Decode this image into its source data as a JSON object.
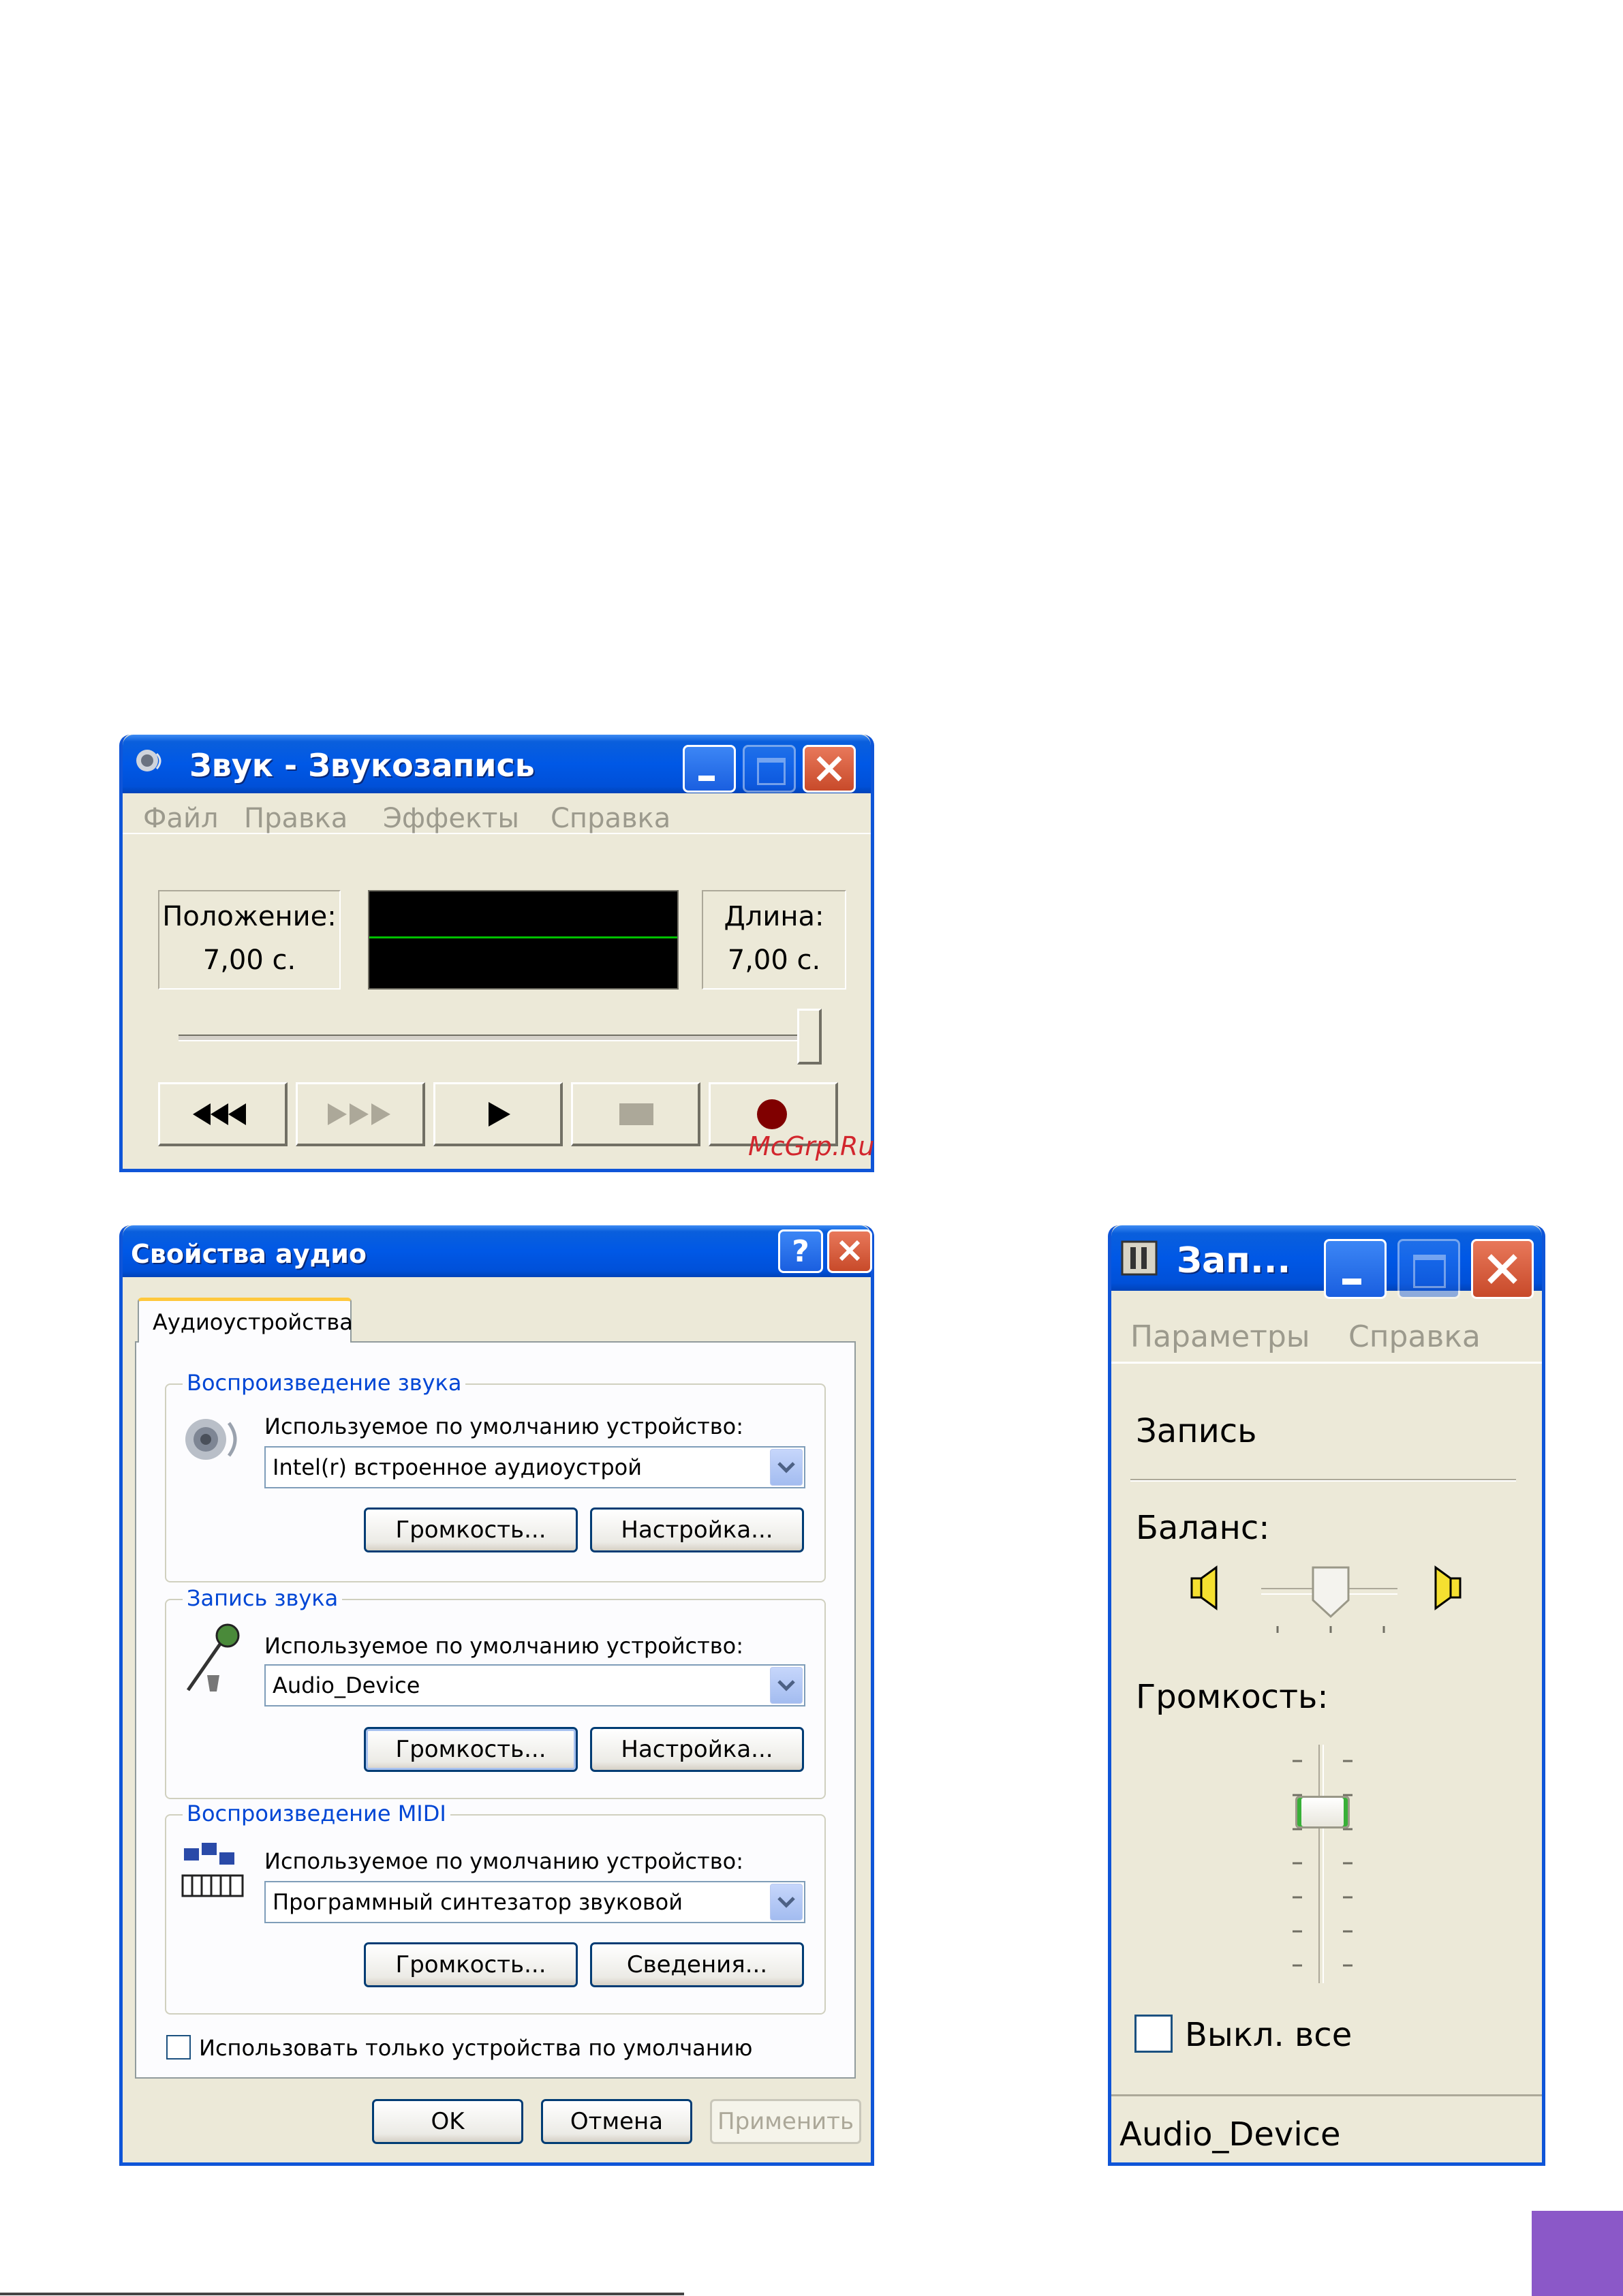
{
  "recorder": {
    "title": "Звук - Звукозапись",
    "menu": [
      "Файл",
      "Правка",
      "Эффекты",
      "Справка"
    ],
    "position_label": "Положение:",
    "position_value": "7,00 с.",
    "length_label": "Длина:",
    "length_value": "7,00 с.",
    "seek_progress": 1.0,
    "controls": [
      "rewind",
      "fast-forward",
      "play",
      "stop",
      "record"
    ],
    "watermark": "McGrp.Ru"
  },
  "audio_props": {
    "title": "Свойства аудио",
    "tab": "Аудиоустройства",
    "playback": {
      "group": "Воспроизведение звука",
      "label": "Используемое по умолчанию устройство:",
      "device": "Intel(r) встроенное аудиоустрой",
      "volume_btn": "Громкость...",
      "settings_btn": "Настройка..."
    },
    "recording": {
      "group": "Запись звука",
      "label": "Используемое по умолчанию устройство:",
      "device": "Audio_Device",
      "volume_btn": "Громкость...",
      "settings_btn": "Настройка..."
    },
    "midi": {
      "group": "Воспроизведение MIDI",
      "label": "Используемое по умолчанию устройство:",
      "device": "Программный синтезатор звуковой",
      "volume_btn": "Громкость...",
      "details_btn": "Сведения..."
    },
    "default_only_checkbox": "Использовать только устройства по умолчанию",
    "ok": "OK",
    "cancel": "Отмена",
    "apply": "Применить"
  },
  "mixer": {
    "title": "Зап...",
    "menu": [
      "Параметры",
      "Справка"
    ],
    "section": "Запись",
    "balance_label": "Баланс:",
    "volume_label": "Громкость:",
    "volume_level": 0.75,
    "mute_label": "Выкл. все",
    "status": "Audio_Device"
  },
  "colors": {
    "titlebar": "#0058e6",
    "window_face": "#ece9d8",
    "wave_green": "#00c000",
    "record_red": "#800000",
    "corner_square": "#8b58c8"
  }
}
